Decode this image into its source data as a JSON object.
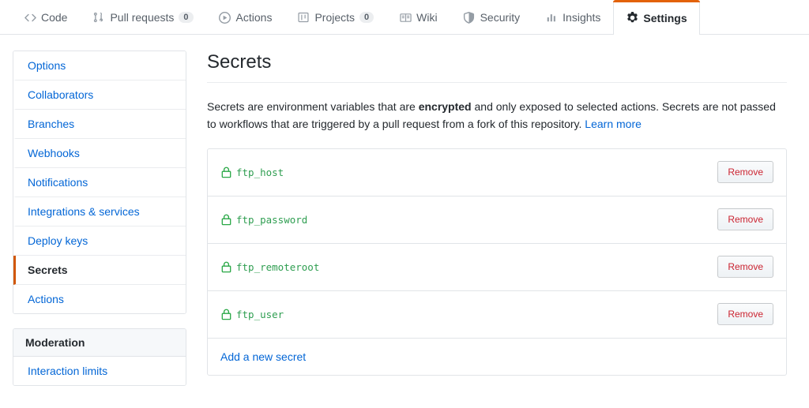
{
  "repo_nav": {
    "tabs": [
      {
        "label": "Code",
        "icon": "code-icon",
        "selected": false
      },
      {
        "label": "Pull requests",
        "icon": "git-pull-request-icon",
        "count": "0",
        "selected": false
      },
      {
        "label": "Actions",
        "icon": "play-icon",
        "selected": false
      },
      {
        "label": "Projects",
        "icon": "project-icon",
        "count": "0",
        "selected": false
      },
      {
        "label": "Wiki",
        "icon": "book-icon",
        "selected": false
      },
      {
        "label": "Security",
        "icon": "shield-icon",
        "selected": false
      },
      {
        "label": "Insights",
        "icon": "graph-icon",
        "selected": false
      },
      {
        "label": "Settings",
        "icon": "gear-icon",
        "selected": true
      }
    ]
  },
  "sidebar": {
    "settings_menu": {
      "items": [
        {
          "label": "Options",
          "selected": false
        },
        {
          "label": "Collaborators",
          "selected": false
        },
        {
          "label": "Branches",
          "selected": false
        },
        {
          "label": "Webhooks",
          "selected": false
        },
        {
          "label": "Notifications",
          "selected": false
        },
        {
          "label": "Integrations & services",
          "selected": false
        },
        {
          "label": "Deploy keys",
          "selected": false
        },
        {
          "label": "Secrets",
          "selected": true
        },
        {
          "label": "Actions",
          "selected": false
        }
      ]
    },
    "moderation_menu": {
      "heading": "Moderation",
      "items": [
        {
          "label": "Interaction limits",
          "selected": false
        }
      ]
    }
  },
  "main": {
    "title": "Secrets",
    "intro": {
      "part1": "Secrets are environment variables that are ",
      "emphasis": "encrypted",
      "part2": " and only exposed to selected actions. Secrets are not passed to workflows that are triggered by a pull request from a fork of this repository. ",
      "link_label": "Learn more"
    },
    "secrets": [
      {
        "name": "ftp_host",
        "remove_label": "Remove"
      },
      {
        "name": "ftp_password",
        "remove_label": "Remove"
      },
      {
        "name": "ftp_remoteroot",
        "remove_label": "Remove"
      },
      {
        "name": "ftp_user",
        "remove_label": "Remove"
      }
    ],
    "add_secret_label": "Add a new secret"
  },
  "colors": {
    "accent_orange": "#e36209",
    "link_blue": "#0366d6",
    "secret_green": "#2f9e51",
    "danger_red": "#cb2431",
    "border_gray": "#e1e4e8"
  }
}
